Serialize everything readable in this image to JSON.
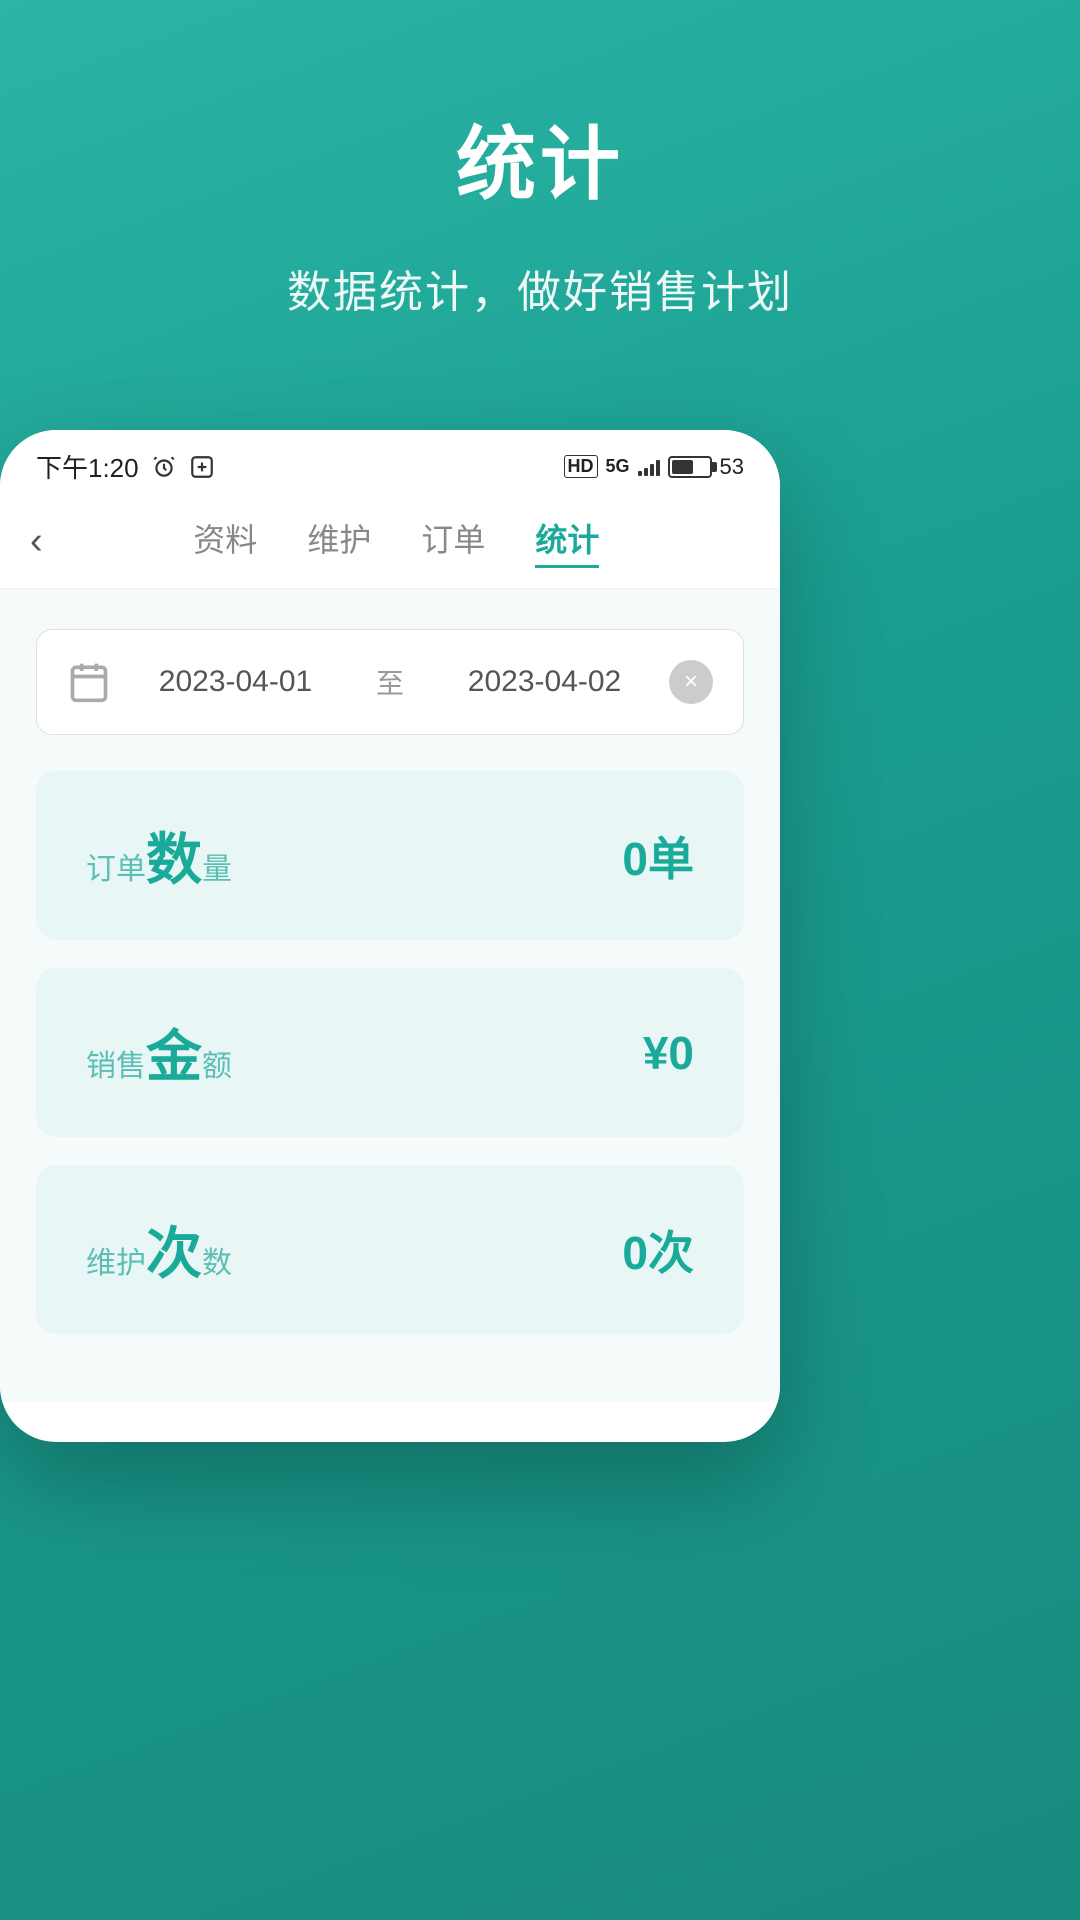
{
  "page": {
    "title": "统计",
    "subtitle": "数据统计，做好销售计划",
    "background_color": "#2ab5a5"
  },
  "status_bar": {
    "time": "下午1:20",
    "icons": [
      "alarm",
      "nfc"
    ],
    "network": "HD 5G",
    "battery": "53"
  },
  "nav": {
    "back_label": "‹",
    "tabs": [
      {
        "id": "ziliao",
        "label": "资料",
        "active": false
      },
      {
        "id": "weihu",
        "label": "维护",
        "active": false
      },
      {
        "id": "dingdan",
        "label": "订单",
        "active": false
      },
      {
        "id": "tongji",
        "label": "统计",
        "active": true
      }
    ]
  },
  "date_range": {
    "start_date": "2023-04-01",
    "separator": "至",
    "end_date": "2023-04-02",
    "clear_icon": "×"
  },
  "stats": [
    {
      "id": "order-count",
      "label_prefix": "订单",
      "label_big": "数",
      "label_suffix": "量",
      "value": "0单"
    },
    {
      "id": "sales-amount",
      "label_prefix": "销售",
      "label_big": "金",
      "label_suffix": "额",
      "value": "¥0"
    },
    {
      "id": "maintenance-count",
      "label_prefix": "维护",
      "label_big": "次",
      "label_suffix": "数",
      "value": "0次"
    }
  ]
}
